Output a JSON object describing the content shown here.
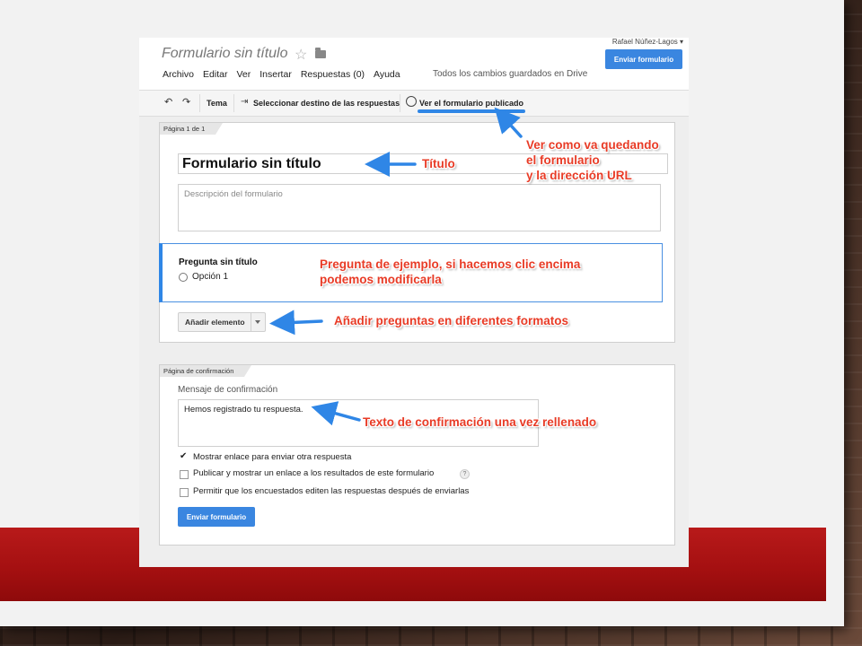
{
  "app": {
    "doc_title": "Formulario sin título",
    "user": "Rafael Núñez-Lagos ▾",
    "send_button": "Enviar formulario",
    "saved_status": "Todos los cambios guardados en Drive"
  },
  "menu": [
    "Archivo",
    "Editar",
    "Ver",
    "Insertar",
    "Respuestas (0)",
    "Ayuda"
  ],
  "toolbar": {
    "undo": "↶",
    "redo": "↷",
    "theme": "Tema",
    "destination": "Seleccionar destino de las respuestas",
    "view_published": "Ver el formulario publicado"
  },
  "page1": {
    "tab": "Página 1 de 1",
    "form_title": "Formulario sin título",
    "description_placeholder": "Descripción del formulario",
    "question_title": "Pregunta sin título",
    "option1": "Opción 1",
    "add_item": "Añadir elemento"
  },
  "confirmation": {
    "tab": "Página de confirmación",
    "label": "Mensaje de confirmación",
    "message": "Hemos registrado tu respuesta.",
    "options": [
      {
        "label": "Mostrar enlace para enviar otra respuesta",
        "checked": true
      },
      {
        "label": "Publicar y mostrar un enlace a los resultados de este formulario",
        "checked": false,
        "help": "?"
      },
      {
        "label": "Permitir que los encuestados editen las respuestas después de enviarlas",
        "checked": false
      }
    ],
    "send_button": "Enviar formulario"
  },
  "annotations": {
    "title_note": "Título",
    "view_note_line1": "Ver como va quedando",
    "view_note_line2": "el formulario",
    "view_note_line3": "y la dirección URL",
    "question_note_line1": "Pregunta de ejemplo, si hacemos clic encima",
    "question_note_line2": "podemos modificarla",
    "add_note": "Añadir preguntas en diferentes formatos",
    "confirm_note": "Texto de confirmación una vez rellenado"
  },
  "colors": {
    "accent_blue": "#3a86e0",
    "annotation_red": "#e83b26",
    "band_red": "#b81a1a"
  }
}
